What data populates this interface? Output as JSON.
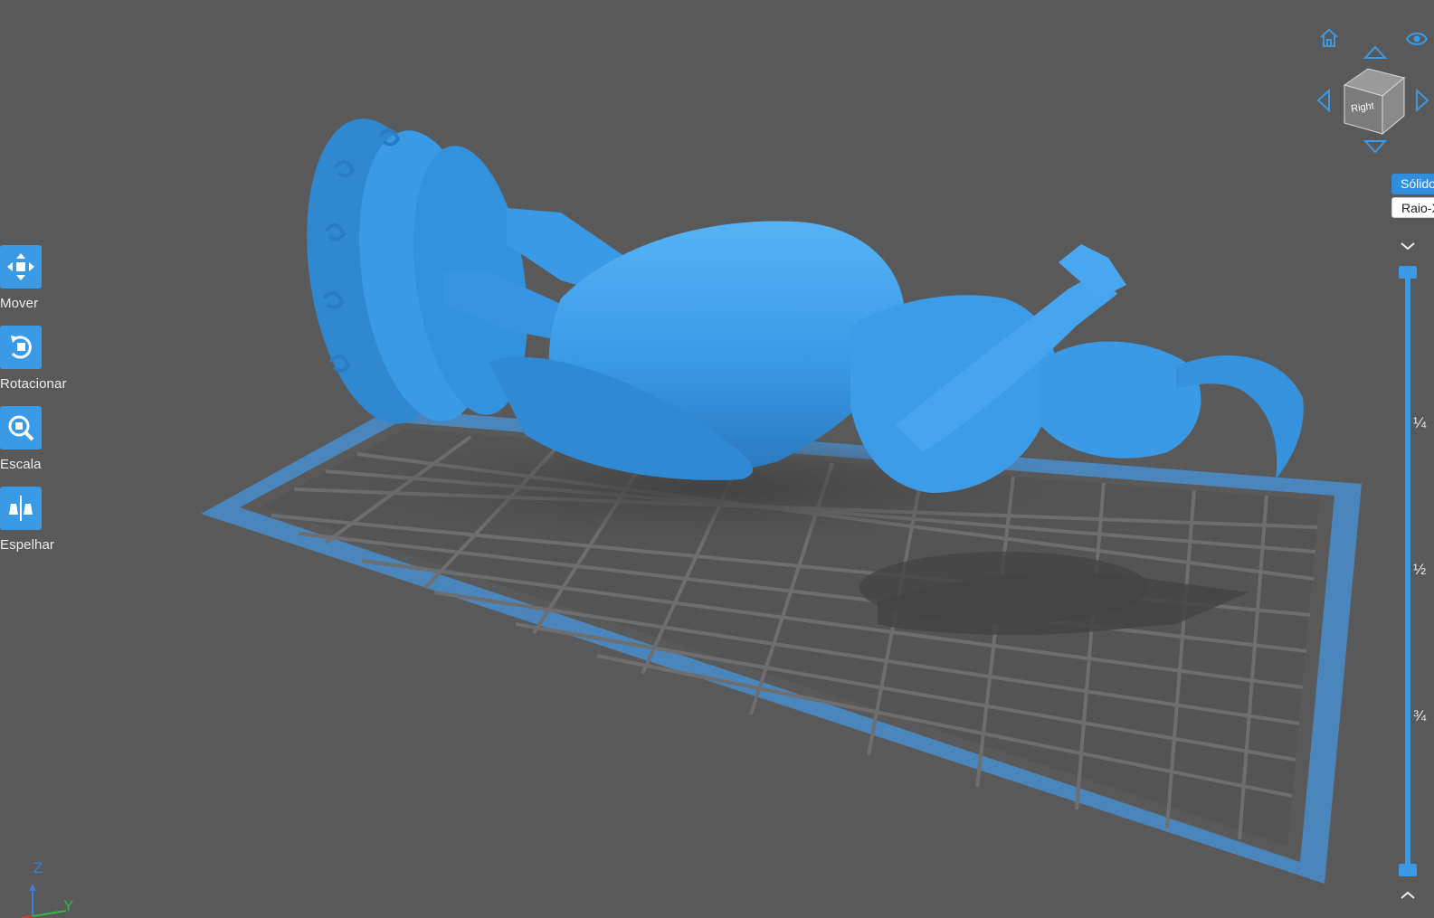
{
  "scene": {
    "model_name_visible": "",
    "background_color": "#595959",
    "build_plate_color": "#4a8ec9",
    "model_color": "#3ea0ee"
  },
  "left_toolbar": {
    "tools": [
      {
        "id": "move",
        "label": "Mover",
        "icon": "move-arrows-icon"
      },
      {
        "id": "rotate",
        "label": "Rotacionar",
        "icon": "rotate-icon"
      },
      {
        "id": "scale",
        "label": "Escala",
        "icon": "scale-icon"
      },
      {
        "id": "mirror",
        "label": "Espelhar",
        "icon": "mirror-icon"
      }
    ]
  },
  "view_cube": {
    "face_label": "Right",
    "icons": [
      "home-icon",
      "eye-icon",
      "arrow-up-icon",
      "arrow-down-icon",
      "arrow-left-icon",
      "arrow-right-icon"
    ]
  },
  "render_modes": {
    "solid_label": "Sólido",
    "xray_label": "Raio-X",
    "selected": "Sólido"
  },
  "layer_slider": {
    "ticks": [
      "¼",
      "½",
      "¾"
    ]
  },
  "axis_indicator": {
    "z_label": "Z",
    "y_label": "Y",
    "z_color": "#3a7fd6",
    "y_color": "#39b54a",
    "x_color": "#d63a3a"
  }
}
